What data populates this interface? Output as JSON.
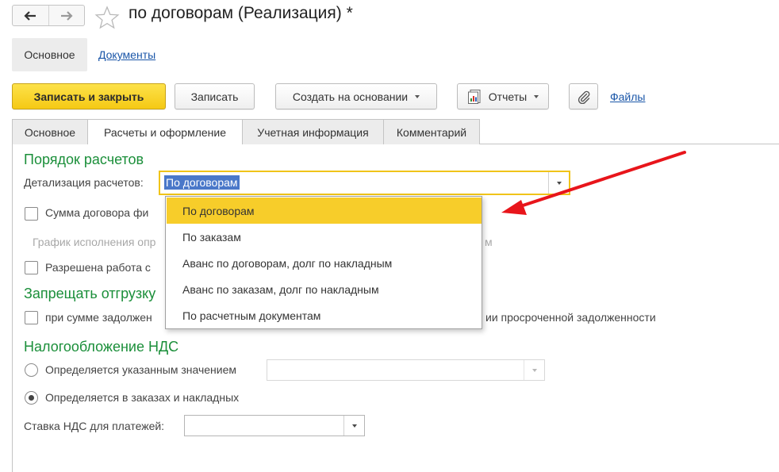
{
  "header": {
    "title": "по договорам (Реализация) *"
  },
  "sections": {
    "current": "Основное",
    "link": "Документы"
  },
  "toolbar": {
    "save_close": "Записать и закрыть",
    "save": "Записать",
    "create_based": "Создать на основании",
    "reports": "Отчеты",
    "files": "Файлы"
  },
  "tabs": [
    {
      "label": "Основное"
    },
    {
      "label": "Расчеты и оформление"
    },
    {
      "label": "Учетная информация"
    },
    {
      "label": "Комментарий"
    }
  ],
  "form": {
    "settlement_order_title": "Порядок расчетов",
    "detail_label": "Детализация расчетов:",
    "detail_value": "По договорам",
    "contract_sum_label": "Сумма договора фи",
    "schedule_label": "График исполнения опр",
    "schedule_tail": "м",
    "allowed_work_label": "Разрешена работа с",
    "forbid_title": "Запрещать отгрузку",
    "forbid_sum_label": "при сумме задолжен",
    "forbid_sum_tail": "ии просроченной задолженности",
    "vat_title": "Налогообложение НДС",
    "vat_option1": "Определяется указанным значением",
    "vat_option2": "Определяется в заказах и накладных",
    "vat_rate_label": "Ставка НДС для платежей:",
    "vat_selected_option": 2
  },
  "dropdown": {
    "items": [
      "По договорам",
      "По заказам",
      "Аванс по договорам, долг по накладным",
      "Аванс по заказам, долг по накладным",
      "По расчетным документам"
    ],
    "selected_index": 0
  },
  "colors": {
    "accent_yellow": "#f7cd2a",
    "group_title_green": "#1b8f3a",
    "link_blue": "#1a56a8",
    "annotation_arrow": "#e8151b"
  }
}
